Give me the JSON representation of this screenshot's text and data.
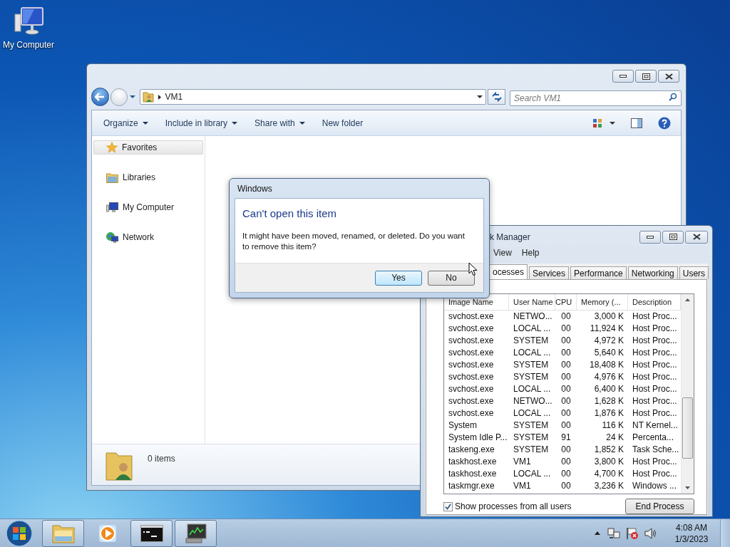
{
  "desktop": {
    "icons": [
      {
        "label": "My Computer"
      }
    ]
  },
  "explorer": {
    "address": "VM1",
    "search": {
      "placeholder": "Search VM1"
    },
    "toolbar": [
      {
        "label": "Organize",
        "dropdown": true
      },
      {
        "label": "Include in library",
        "dropdown": true
      },
      {
        "label": "Share with",
        "dropdown": true
      },
      {
        "label": "New folder",
        "dropdown": false
      }
    ],
    "nav": [
      {
        "label": "Favorites",
        "kind": "favorites",
        "selected": true
      },
      {
        "label": "Libraries",
        "kind": "libraries",
        "selected": false
      },
      {
        "label": "My Computer",
        "kind": "computer",
        "selected": false
      },
      {
        "label": "Network",
        "kind": "network",
        "selected": false
      }
    ],
    "status": "0 items"
  },
  "dialog": {
    "title": "Windows",
    "heading": "Can't open this item",
    "message": "It might have been moved, renamed, or deleted. Do you want to remove this item?",
    "buttons": [
      {
        "label": "Yes",
        "selected": true
      },
      {
        "label": "No",
        "selected": false
      }
    ]
  },
  "task_manager": {
    "title": "k Manager",
    "menu": [
      "View",
      "Help"
    ],
    "tabs": [
      {
        "label": "ocesses",
        "selected": true
      },
      {
        "label": "Services",
        "selected": false
      },
      {
        "label": "Performance",
        "selected": false
      },
      {
        "label": "Networking",
        "selected": false
      },
      {
        "label": "Users",
        "selected": false
      }
    ],
    "columns": [
      "Image Name",
      "User Name",
      "CPU",
      "Memory (...",
      "Description"
    ],
    "rows": [
      [
        "svchost.exe",
        "NETWO...",
        "00",
        "3,000 K",
        "Host Proc..."
      ],
      [
        "svchost.exe",
        "LOCAL ...",
        "00",
        "11,924 K",
        "Host Proc..."
      ],
      [
        "svchost.exe",
        "SYSTEM",
        "00",
        "4,972 K",
        "Host Proc..."
      ],
      [
        "svchost.exe",
        "LOCAL ...",
        "00",
        "5,640 K",
        "Host Proc..."
      ],
      [
        "svchost.exe",
        "SYSTEM",
        "00",
        "18,408 K",
        "Host Proc..."
      ],
      [
        "svchost.exe",
        "SYSTEM",
        "00",
        "4,976 K",
        "Host Proc..."
      ],
      [
        "svchost.exe",
        "LOCAL ...",
        "00",
        "6,400 K",
        "Host Proc..."
      ],
      [
        "svchost.exe",
        "NETWO...",
        "00",
        "1,628 K",
        "Host Proc..."
      ],
      [
        "svchost.exe",
        "LOCAL ...",
        "00",
        "1,876 K",
        "Host Proc..."
      ],
      [
        "System",
        "SYSTEM",
        "00",
        "116 K",
        "NT Kernel..."
      ],
      [
        "System Idle P...",
        "SYSTEM",
        "91",
        "24 K",
        "Percenta..."
      ],
      [
        "taskeng.exe",
        "SYSTEM",
        "00",
        "1,852 K",
        "Task Sche..."
      ],
      [
        "taskhost.exe",
        "VM1",
        "00",
        "3,800 K",
        "Host Proc..."
      ],
      [
        "taskhost.exe",
        "LOCAL ...",
        "00",
        "4,700 K",
        "Host Proc..."
      ],
      [
        "taskmgr.exe",
        "VM1",
        "00",
        "3,236 K",
        "Windows ..."
      ]
    ],
    "show_all": {
      "label": "Show processes from all users",
      "checked": true
    },
    "button": "End Process"
  },
  "taskbar": {
    "apps": [
      {
        "kind": "explorer",
        "running": true
      },
      {
        "kind": "media",
        "running": false
      },
      {
        "kind": "console",
        "running": true
      },
      {
        "kind": "monitor",
        "running": true
      }
    ],
    "time": "4:08 AM",
    "date": "1/3/2023"
  }
}
